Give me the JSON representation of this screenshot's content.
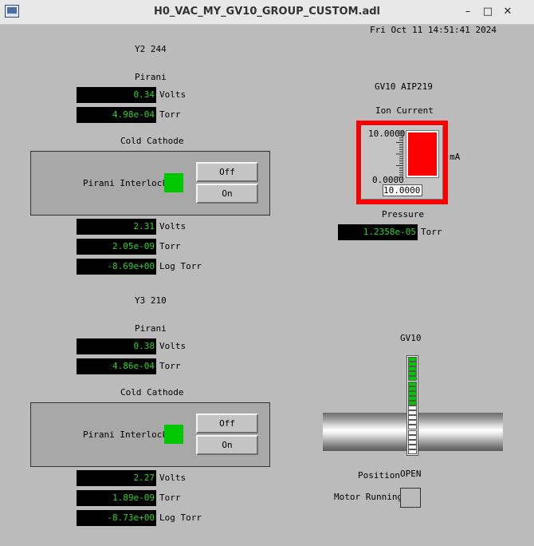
{
  "window": {
    "title": "H0_VAC_MY_GV10_GROUP_CUSTOM.adl",
    "minimize": "–",
    "maximize": "□",
    "close": "✕"
  },
  "datetime": "Fri Oct 11 14:51:41 2024",
  "y2": {
    "title": "Y2 244",
    "pirani_label": "Pirani",
    "pirani_volts": "0.34",
    "pirani_torr": "4.98e-04",
    "cold_cathode_label": "Cold Cathode",
    "interlock_label": "Pirani Interlock",
    "off_label": "Off",
    "on_label": "On",
    "cc_volts": "2.31",
    "cc_torr": "2.05e-09",
    "cc_logtorr": "-8.69e+00"
  },
  "y3": {
    "title": "Y3 210",
    "pirani_label": "Pirani",
    "pirani_volts": "0.38",
    "pirani_torr": "4.86e-04",
    "cold_cathode_label": "Cold Cathode",
    "interlock_label": "Pirani Interlock",
    "off_label": "Off",
    "on_label": "On",
    "cc_volts": "2.27",
    "cc_torr": "1.89e-09",
    "cc_logtorr": "-8.73e+00"
  },
  "units": {
    "volts": "Volts",
    "torr": "Torr",
    "logtorr": "Log Torr",
    "ma": "mA"
  },
  "aip": {
    "title": "GV10 AIP219",
    "ion_current_label": "Ion Current",
    "meter_max": "10.0000",
    "meter_min": "0.0000",
    "meter_value": "10.0000",
    "meter_level": 1.0,
    "pressure_label": "Pressure",
    "pressure_value": "1.2358e-05"
  },
  "gv10": {
    "title": "GV10",
    "position_label": "Position",
    "position_value": "OPEN",
    "motor_label": "Motor Running",
    "segments_green": 10,
    "segments_total": 20
  },
  "colors": {
    "led_green": "#00c800",
    "readback_text": "#2cd42c",
    "alarm_red": "#ff0000"
  }
}
